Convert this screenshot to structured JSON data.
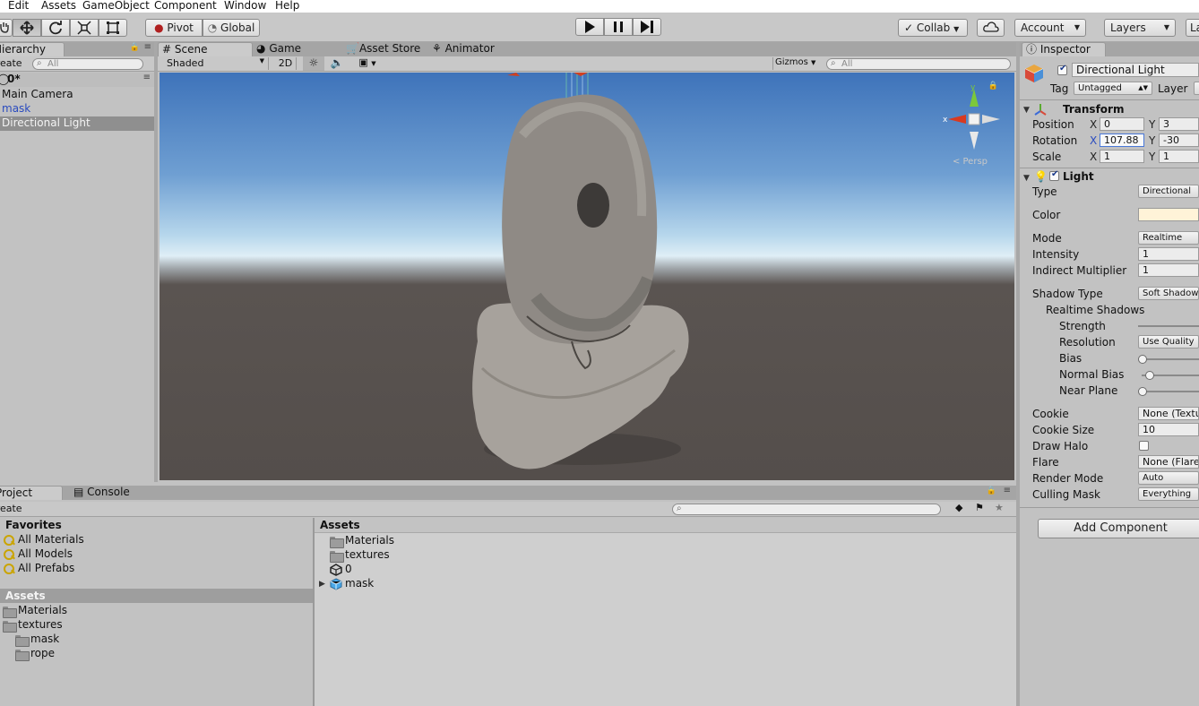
{
  "menu": [
    "Edit",
    "Assets",
    "GameObject",
    "Component",
    "Window",
    "Help"
  ],
  "toolbar": {
    "pivot_label": "Pivot",
    "global_label": "Global",
    "collab_label": "Collab",
    "account_label": "Account",
    "layers_label": "Layers",
    "layout_label": "La",
    "tools": [
      "hand-icon",
      "move-icon",
      "rotate-icon",
      "scale-icon",
      "rect-icon"
    ],
    "play": [
      "play-icon",
      "pause-icon",
      "step-icon"
    ]
  },
  "hierarchy": {
    "tab": "Hierarchy",
    "create_label": "Create",
    "search_placeholder": "All",
    "scene_name": "0*",
    "items": [
      {
        "label": "Main Camera",
        "color": "#111111"
      },
      {
        "label": "mask",
        "color": "#2a4bbf"
      },
      {
        "label": "Directional Light",
        "color": "#111111",
        "selected": true
      }
    ]
  },
  "scene": {
    "tabs": [
      "Scene",
      "Game",
      "Asset Store",
      "Animator"
    ],
    "shading_label": "Shaded",
    "twod_label": "2D",
    "gizmos_label": "Gizmos",
    "search_placeholder": "All",
    "persp_label": "Persp"
  },
  "project": {
    "tabs": [
      "Project",
      "Console"
    ],
    "create_label": "Create",
    "favorites_title": "Favorites",
    "favorites": [
      "All Materials",
      "All Models",
      "All Prefabs"
    ],
    "assets_title": "Assets",
    "tree": [
      "Materials",
      "textures",
      "mask",
      "rope"
    ],
    "content_title": "Assets",
    "content_items": [
      {
        "label": "Materials",
        "icon": "folder-icon"
      },
      {
        "label": "textures",
        "icon": "folder-icon"
      },
      {
        "label": "0",
        "icon": "unity-scene-icon"
      },
      {
        "label": "mask",
        "icon": "prefab-icon"
      }
    ]
  },
  "inspector": {
    "tab": "Inspector",
    "object_name": "Directional Light",
    "tag_label": "Tag",
    "tag_value": "Untagged",
    "layer_label": "Layer",
    "transform": {
      "title": "Transform",
      "position_label": "Position",
      "rotation_label": "Rotation",
      "scale_label": "Scale",
      "position": {
        "x": "0",
        "y": "3"
      },
      "rotation": {
        "x": "107.88",
        "y": "-30"
      },
      "scale": {
        "x": "1",
        "y": "1"
      },
      "x_label": "X",
      "y_label": "Y"
    },
    "light": {
      "title": "Light",
      "type_label": "Type",
      "type_value": "Directional",
      "color_label": "Color",
      "color_value": "#fff3d8",
      "mode_label": "Mode",
      "mode_value": "Realtime",
      "intensity_label": "Intensity",
      "intensity_value": "1",
      "indirect_label": "Indirect Multiplier",
      "indirect_value": "1",
      "shadow_type_label": "Shadow Type",
      "shadow_type_value": "Soft Shadow",
      "realtime_shadows_label": "Realtime Shadows",
      "strength_label": "Strength",
      "resolution_label": "Resolution",
      "resolution_value": "Use Quality",
      "bias_label": "Bias",
      "normal_bias_label": "Normal Bias",
      "near_plane_label": "Near Plane",
      "cookie_label": "Cookie",
      "cookie_value": "None (Textu",
      "cookie_size_label": "Cookie Size",
      "cookie_size_value": "10",
      "draw_halo_label": "Draw Halo",
      "flare_label": "Flare",
      "flare_value": "None (Flare",
      "render_mode_label": "Render Mode",
      "render_mode_value": "Auto",
      "culling_mask_label": "Culling Mask",
      "culling_mask_value": "Everything"
    },
    "add_component_label": "Add Component"
  }
}
